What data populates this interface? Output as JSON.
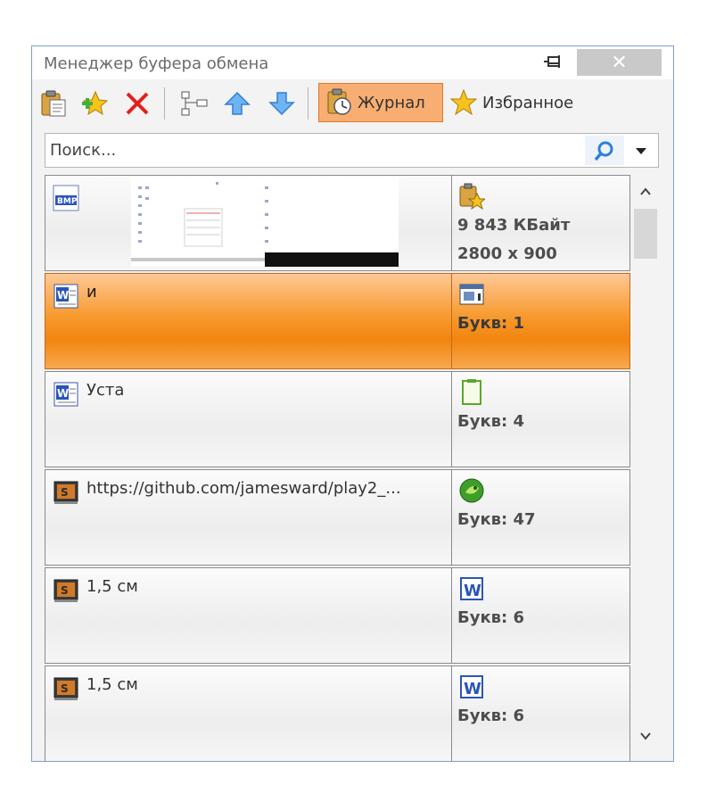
{
  "window": {
    "title": "Менеджер буфера обмена",
    "close_glyph": "✕"
  },
  "toolbar": {
    "buttons": [
      {
        "name": "paste-icon"
      },
      {
        "name": "add-favorite-icon"
      },
      {
        "name": "delete-icon"
      },
      {
        "name": "tree-icon"
      },
      {
        "name": "move-up-icon"
      },
      {
        "name": "move-down-icon"
      }
    ],
    "tabs": {
      "journal": "Журнал",
      "favorites": "Избранное"
    },
    "active_tab": "journal"
  },
  "search": {
    "placeholder": "Поиск...",
    "value": ""
  },
  "items": [
    {
      "kind": "image",
      "type_icon": "bmp-file-icon",
      "source_icon": "clipboard-star-icon",
      "text": "",
      "info": [
        "9 843 КБайт",
        "2800 x 900"
      ],
      "selected": false
    },
    {
      "kind": "text",
      "type_icon": "word-doc-icon",
      "source_icon": "window-app-icon",
      "text": "и",
      "info": [
        "Букв: 1"
      ],
      "selected": true
    },
    {
      "kind": "text",
      "type_icon": "word-doc-icon",
      "source_icon": "notepad-icon",
      "text": "Уста",
      "info": [
        "Букв: 4"
      ],
      "selected": false
    },
    {
      "kind": "text",
      "type_icon": "sublime-icon",
      "source_icon": "green-app-icon",
      "text": "https://github.com/jamesward/play2_...",
      "info": [
        "Букв: 47"
      ],
      "selected": false
    },
    {
      "kind": "text",
      "type_icon": "sublime-icon",
      "source_icon": "word-app-icon",
      "text": "1,5 см",
      "info": [
        "Букв: 6"
      ],
      "selected": false
    },
    {
      "kind": "text",
      "type_icon": "sublime-icon",
      "source_icon": "word-app-icon",
      "text": "1,5 см",
      "info": [
        "Букв: 6"
      ],
      "selected": false
    }
  ],
  "colors": {
    "selected_row": "#f2850f",
    "active_tab": "#f8ae73",
    "window_border": "#7d9fcc",
    "accent_blue": "#2f7fd6"
  }
}
